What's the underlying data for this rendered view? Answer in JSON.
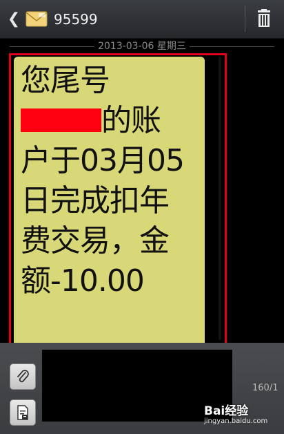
{
  "header": {
    "contact": "95599",
    "back_icon": "chevron-left-icon",
    "envelope_icon": "envelope-icon",
    "trash_icon": "trash-icon"
  },
  "conversation": {
    "date_divider": "2013-03-06 星期三"
  },
  "message": {
    "text_before": "您尾号",
    "text_after": "的账户于03月05日完成扣年费交易，金额-10.00",
    "bubble_color": "#d9d878"
  },
  "composer": {
    "char_counter": "160/1",
    "attach_icon": "paperclip-icon",
    "template_icon": "template-icon",
    "input_value": ""
  },
  "watermark": {
    "brand": "Bai经验",
    "url": "jingyan.baidu.com"
  },
  "colors": {
    "highlight": "#e3001b",
    "redaction": "#ff0010"
  }
}
